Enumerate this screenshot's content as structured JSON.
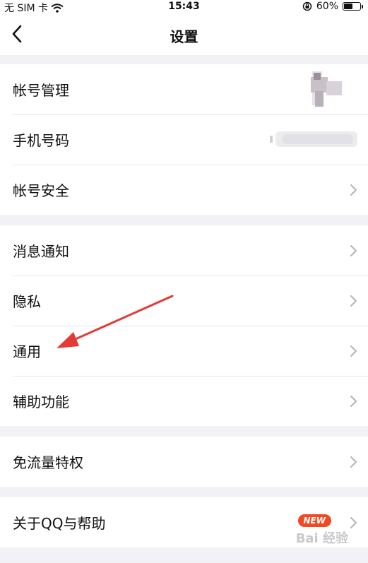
{
  "status_bar": {
    "carrier": "无 SIM 卡",
    "time": "15:43",
    "battery_percent": "60%",
    "battery_level": 0.6
  },
  "nav": {
    "title": "设置",
    "back_icon": "chevron-left-icon"
  },
  "groups": [
    {
      "items": [
        {
          "label": "帐号管理",
          "right": "blurred-avatar"
        },
        {
          "label": "手机号码",
          "right": "blurred-text"
        },
        {
          "label": "帐号安全",
          "right": "chevron-right-icon"
        }
      ]
    },
    {
      "items": [
        {
          "label": "消息通知",
          "right": "chevron-right-icon"
        },
        {
          "label": "隐私",
          "right": "chevron-right-icon"
        },
        {
          "label": "通用",
          "right": "chevron-right-icon"
        },
        {
          "label": "辅助功能",
          "right": "chevron-right-icon"
        }
      ]
    },
    {
      "items": [
        {
          "label": "免流量特权",
          "right": "chevron-right-icon"
        }
      ]
    },
    {
      "items": [
        {
          "label": "关于QQ与帮助",
          "badge": "NEW",
          "right": "chevron-right-icon"
        }
      ]
    }
  ],
  "colors": {
    "background": "#f2f2f6",
    "badge": "#f04a23",
    "annotation_arrow": "#e23b35"
  },
  "watermark": "Bai 经验"
}
